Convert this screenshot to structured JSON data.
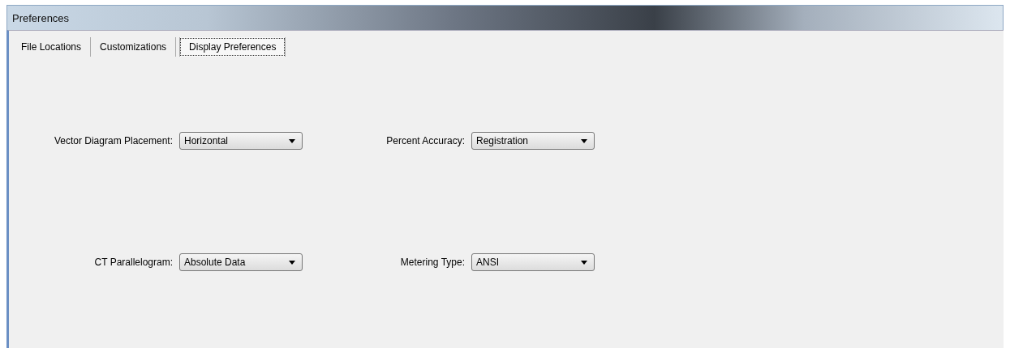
{
  "window": {
    "title": "Preferences"
  },
  "tabs": [
    {
      "label": "File Locations",
      "selected": false
    },
    {
      "label": "Customizations",
      "selected": false
    },
    {
      "label": "Display  Preferences",
      "selected": true
    }
  ],
  "fields": [
    {
      "label": "Vector Diagram Placement:",
      "value": "Horizontal"
    },
    {
      "label": "Percent Accuracy:",
      "value": "Registration"
    },
    {
      "label": "CT Parallelogram:",
      "value": "Absolute Data"
    },
    {
      "label": "Metering Type:",
      "value": "ANSI"
    }
  ]
}
